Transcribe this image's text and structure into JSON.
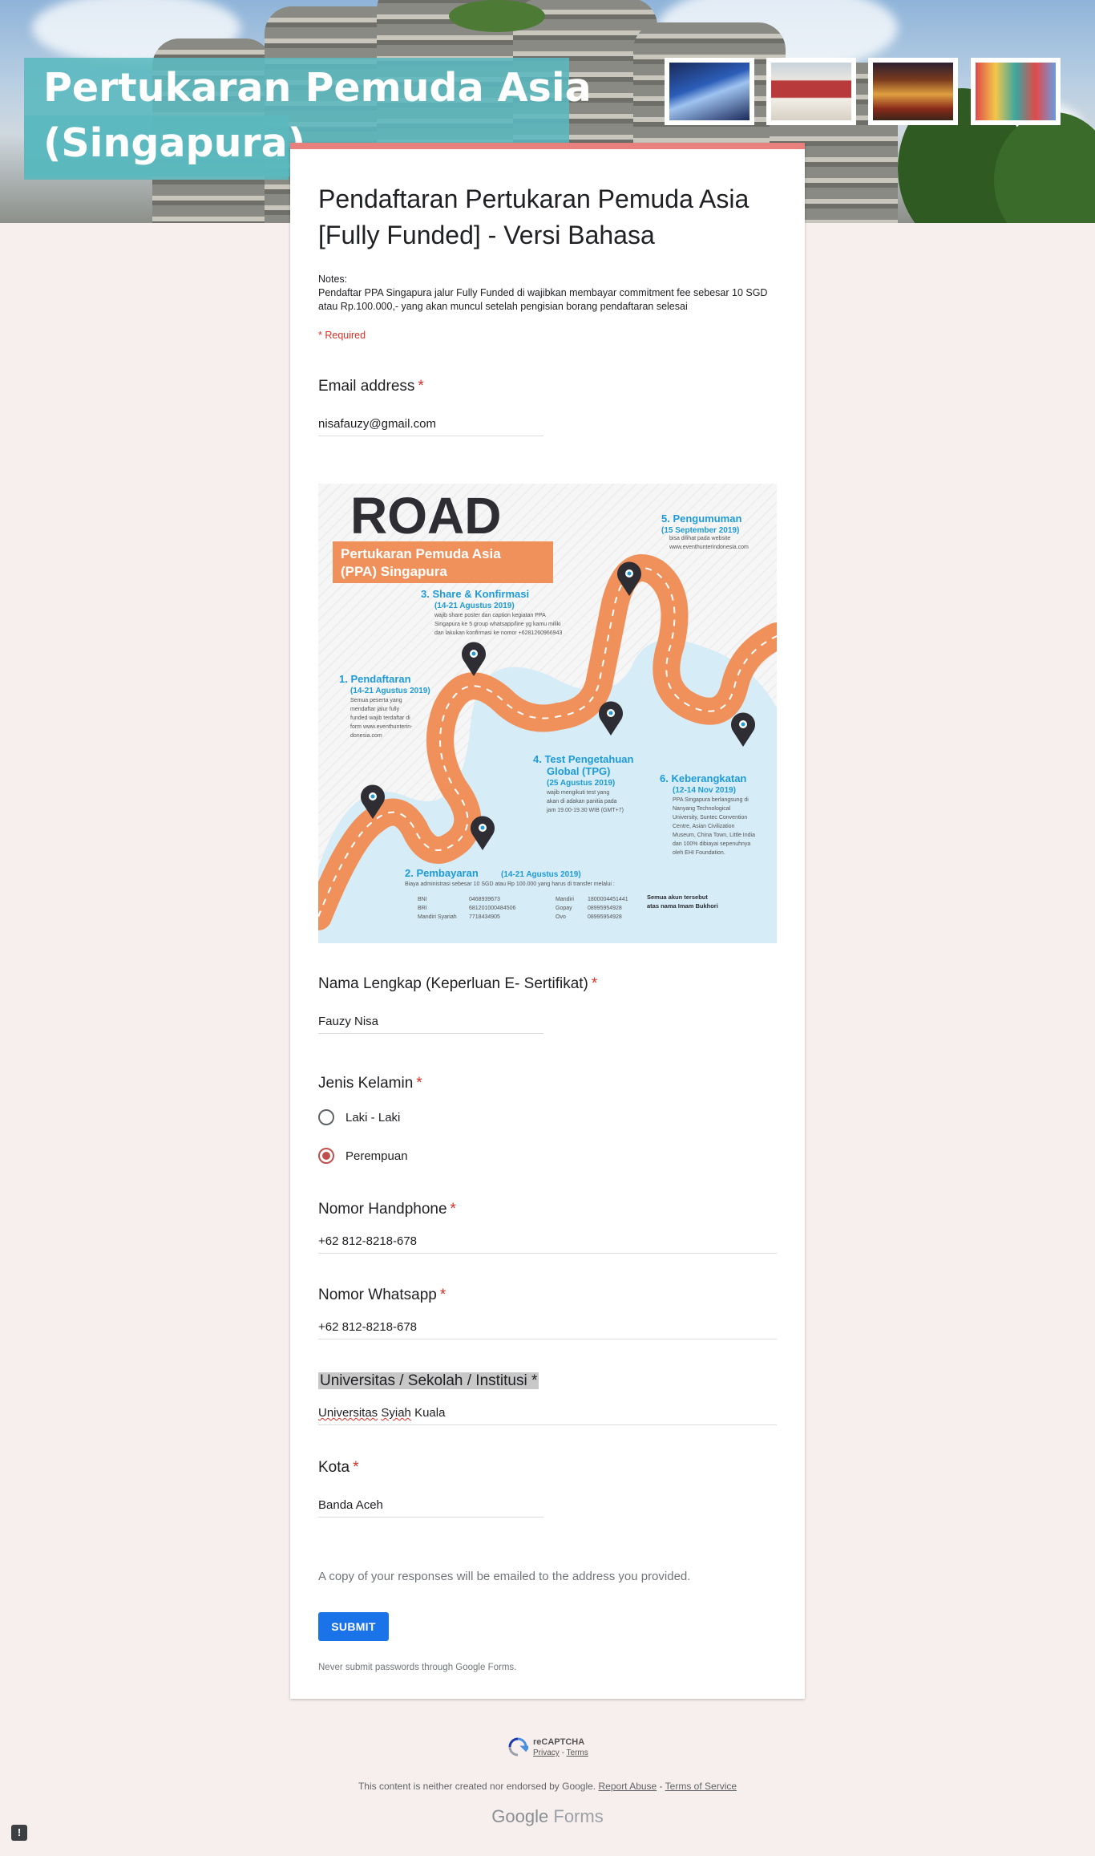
{
  "banner": {
    "title": "Pertukaran Pemuda Asia (Singapura)"
  },
  "form": {
    "title": "Pendaftaran Pertukaran Pemuda Asia [Fully Funded] - Versi Bahasa",
    "notes_label": "Notes:",
    "notes_text": "Pendaftar PPA Singapura jalur Fully Funded di wajibkan membayar commitment fee sebesar 10 SGD atau Rp.100.000,- yang akan muncul setelah pengisian borang pendaftaran selesai",
    "required_note": "* Required",
    "accent_color": "#e8817e",
    "questions": {
      "email": {
        "label": "Email address",
        "value": "nisafauzy@gmail.com"
      },
      "nama": {
        "label": "Nama Lengkap (Keperluan E- Sertifikat)",
        "value": "Fauzy Nisa"
      },
      "jenis_kelamin": {
        "label": "Jenis Kelamin",
        "options": [
          "Laki - Laki",
          "Perempuan"
        ],
        "selected": "Perempuan"
      },
      "handphone": {
        "label": "Nomor Handphone",
        "value": "+62 812-8218-678"
      },
      "whatsapp": {
        "label": "Nomor Whatsapp",
        "value": "+62 812-8218-678"
      },
      "universitas": {
        "label": "Universitas / Sekolah / Institusi",
        "value_word1": "Universitas",
        "value_word2": "Syiah",
        "value_word3": "Kuala"
      },
      "kota": {
        "label": "Kota",
        "value": "Banda Aceh"
      }
    },
    "required_star": "*",
    "copy_note": "A copy of your responses will be emailed to the address you provided.",
    "submit_label": "SUBMIT",
    "password_note": "Never submit passwords through Google Forms."
  },
  "infographic": {
    "heading": "ROAD",
    "banner_line1": "Pertukaran Pemuda Asia",
    "banner_line2": "(PPA) Singapura",
    "steps": [
      {
        "title": "1. Pendaftaran",
        "date": "(14-21 Agustus 2019)",
        "desc": [
          "Semua peserta yang",
          "mendaftar jalur fully",
          "funded wajib terdaftar di",
          "form www.eventhunterin-",
          "donesia.com"
        ]
      },
      {
        "title": "2. Pembayaran",
        "date": "(14-21 Agustus 2019)",
        "desc": [
          "Biaya administrasi sebesar 10 SGD atau Rp 100.000 yang harus di transfer melalui :"
        ]
      },
      {
        "title": "3. Share & Konfirmasi",
        "date": "(14-21 Agustus 2019)",
        "desc": [
          "wajib share poster dan caption kegiatan PPA",
          "Singapura ke 5 group whatsapp/line yg kamu miliki",
          "dan lakukan konfirmasi ke nomor +6281260966943"
        ]
      },
      {
        "title": "4. Test Pengetahuan",
        "title2": "Global (TPG)",
        "date": "(25 Agustus 2019)",
        "desc": [
          "wajib mengikuti test yang",
          "akan di adakan panitia pada",
          "jam 19.00-19.30 WIB (GMT+7)"
        ]
      },
      {
        "title": "5. Pengumuman",
        "date": "(15 September 2019)",
        "desc": [
          "bisa dilihat pada website",
          "www.eventhunterindonesia.com"
        ]
      },
      {
        "title": "6. Keberangkatan",
        "date": "(12-14 Nov 2019)",
        "desc": [
          "PPA Singapura berlangsung di",
          "Nanyang Technological",
          "University, Suntec Convention",
          "Centre, Asian Civilization",
          "Museum, China Town, Little India",
          "dan 100% dibiayai sepenuhnya",
          "oleh EHI Foundation."
        ]
      }
    ],
    "banks": [
      [
        "BNI",
        "0468939673",
        "Mandiri",
        "1800004451441"
      ],
      [
        "BRI",
        "681201000484506",
        "Gopay",
        "08995954928"
      ],
      [
        "Mandiri Syariah",
        "7718434905",
        "Ovo",
        "08995954928"
      ]
    ],
    "accounts_note1": "Semua akun tersebut",
    "accounts_note2": "atas nama Imam Bukhori",
    "colors": {
      "road": "#f0905a",
      "blue": "#1e9bd7",
      "dark": "#2d2d33"
    }
  },
  "footer": {
    "recaptcha": "reCAPTCHA",
    "privacy": "Privacy",
    "dash": " - ",
    "terms": "Terms",
    "disclaimer_text": "This content is neither created nor endorsed by Google.",
    "report_abuse": "Report Abuse",
    "terms_of_service": "Terms of Service",
    "brand_google": "Google",
    "brand_forms": "Forms"
  }
}
